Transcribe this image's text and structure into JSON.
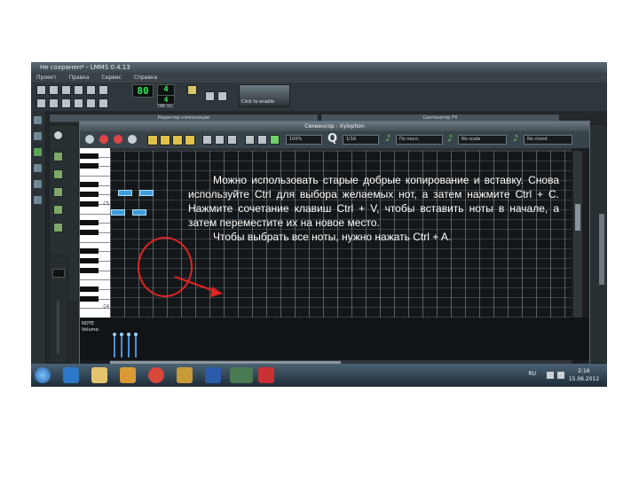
{
  "window": {
    "title": "Не сохранен* - LMMS 0.4.13",
    "menu": [
      "Проект",
      "Правка",
      "Сервис",
      "Справка"
    ]
  },
  "toolbar": {
    "tempo": "80",
    "time_sig_top": "4",
    "time_sig_bottom": "4",
    "time_label": "TIME SIG",
    "vu_label": "Click to enable"
  },
  "panels": {
    "left_title": "Редактор композиции",
    "right_title": "Синтезатор FX"
  },
  "piano_roll": {
    "title": "Секвенсор - Xylophon",
    "zoom": "100%",
    "quantize": "1/16",
    "note_length": "По посл.",
    "scale": "No scale",
    "chord": "No chord",
    "vol_label_1": "NOTE",
    "vol_label_2": "Volume:",
    "key_label_c5": "C5",
    "key_label_c4": "C4"
  },
  "instruction": {
    "paragraph1": "Можно использовать старые добрые копирование и вставку. Снова используйте Ctrl для выбора желаемых нот, а затем нажмите Ctrl + C. Нажмите сочетание клавиш Ctrl + V, чтобы вставить ноты в начале, а затем переместите их на новое место.",
    "paragraph2": "Чтобы выбрать все ноты, нужно нажать Ctrl + A."
  },
  "taskbar": {
    "lang": "RU",
    "time": "2:16",
    "date": "15.06.2012"
  },
  "colors": {
    "accent_red": "#e02424",
    "note_blue": "#3f9ed8",
    "lcd_green": "#36e85a"
  }
}
